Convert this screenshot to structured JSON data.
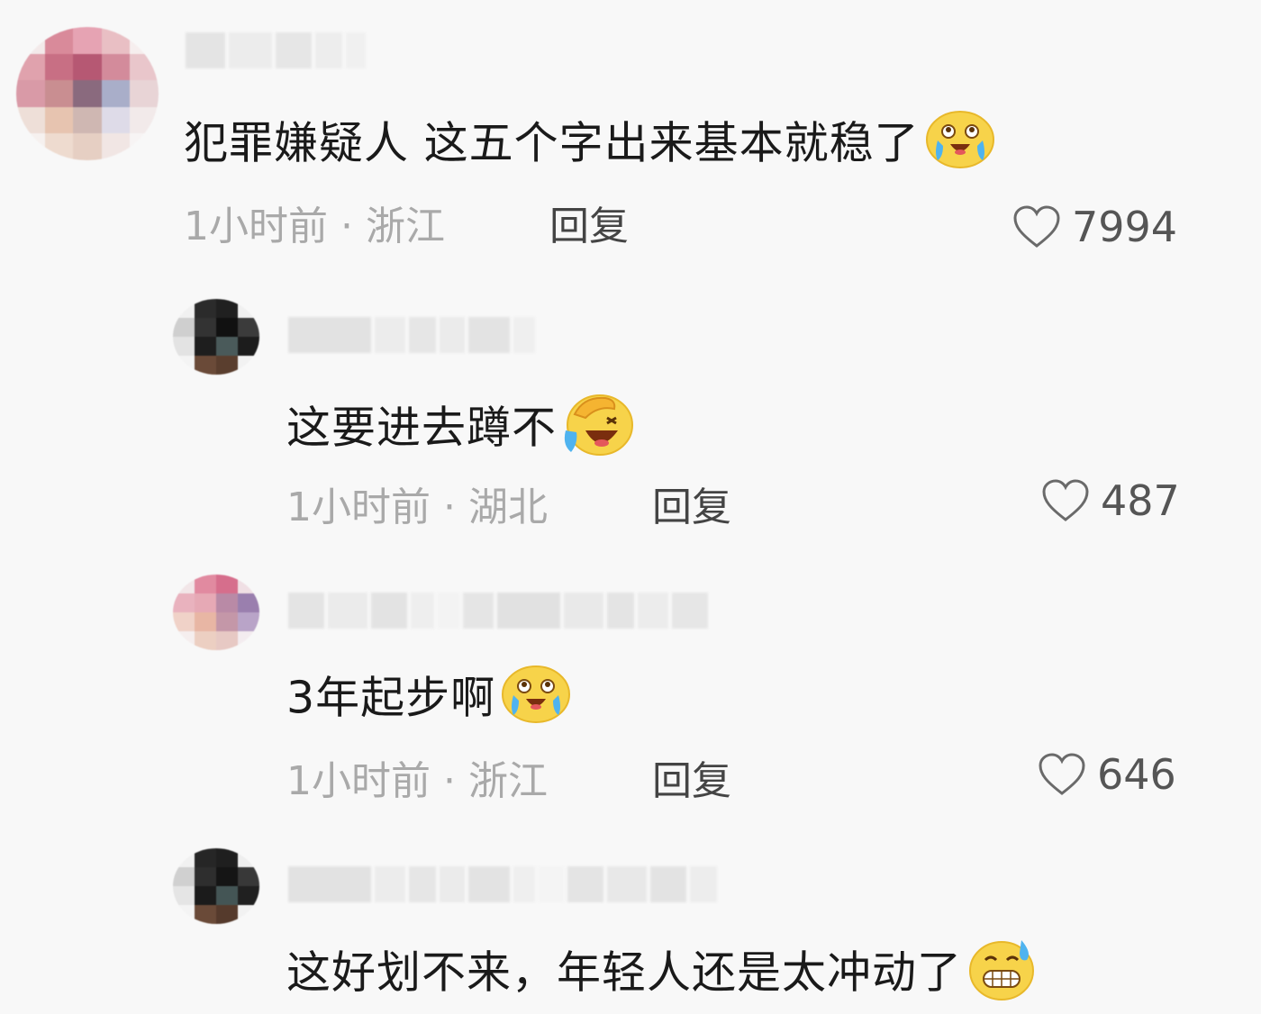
{
  "comments": [
    {
      "text": "犯罪嫌疑人 这五个字出来基本就稳了",
      "time": "1小时前",
      "dot": "·",
      "region": "浙江",
      "reply_label": "回复",
      "likes": "7994",
      "emoji": "crying-laughing-emoji"
    },
    {
      "text": "这要进去蹲不",
      "time": "1小时前",
      "dot": "·",
      "region": "湖北",
      "reply_label": "回复",
      "likes": "487",
      "emoji": "facepalm-laughing-emoji"
    },
    {
      "text": "3年起步啊",
      "time": "1小时前",
      "dot": "·",
      "region": "浙江",
      "reply_label": "回复",
      "likes": "646",
      "emoji": "crying-laughing-emoji"
    },
    {
      "text": "这好划不来，年轻人还是太冲动了",
      "emoji": "sweat-grin-emoji"
    }
  ],
  "colors": {
    "background": "#f8f8f8",
    "meta": "#a9a9a9",
    "text": "#1a1a1a"
  }
}
